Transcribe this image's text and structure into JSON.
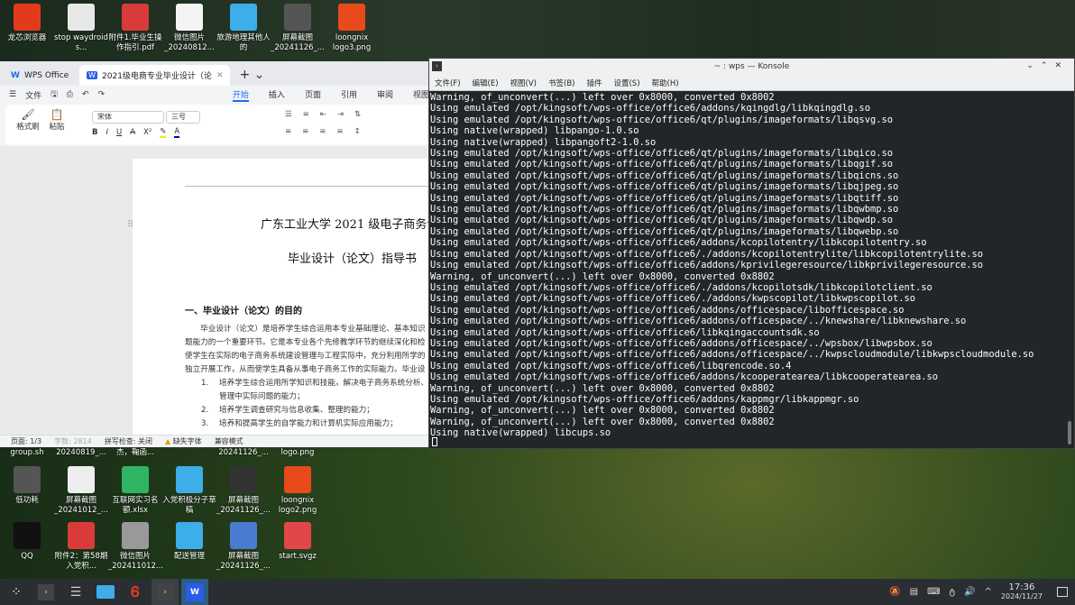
{
  "desktop_top": [
    {
      "label": "龙芯浏览器",
      "icon": "loongson-browser-icon",
      "color": "#e23b1c"
    },
    {
      "label": "stop waydroid s...",
      "icon": "script-file-icon",
      "color": "#e8e8e8"
    },
    {
      "label": "附件1.毕业生操作指引.pdf",
      "icon": "pdf-icon",
      "color": "#d93a3a"
    },
    {
      "label": "微信图片_20240812...",
      "icon": "image-file-icon",
      "color": "#f4f4f4"
    },
    {
      "label": "旅游地理其他人的",
      "icon": "folder-icon",
      "color": "#3daee9"
    },
    {
      "label": "屏幕截图_20241126_...",
      "icon": "screenshot-icon",
      "color": "#555"
    },
    {
      "label": "loongnix logo3.png",
      "icon": "loongnix-logo-icon",
      "color": "#e84a1c"
    }
  ],
  "desktop_bottom_partial": [
    "group.sh",
    "20240819_...",
    "杰，鞠函...",
    "20241126_...",
    "logo.png"
  ],
  "desktop_bottom": [
    {
      "label": "低功耗",
      "icon": "terminal-script-icon",
      "color": "#555"
    },
    {
      "label": "屏幕截图_20241012_...",
      "icon": "screenshot-icon",
      "color": "#eee"
    },
    {
      "label": "互联网实习名额.xlsx",
      "icon": "spreadsheet-icon",
      "color": "#2fb464"
    },
    {
      "label": "入党积极分子草稿",
      "icon": "folder-icon",
      "color": "#3daee9"
    },
    {
      "label": "屏幕截图_20241126_...",
      "icon": "screenshot-icon",
      "color": "#333"
    },
    {
      "label": "loongnix logo2.png",
      "icon": "loongnix-logo-icon",
      "color": "#e84a1c"
    },
    {
      "label": "QQ",
      "icon": "qq-icon",
      "color": "#111"
    },
    {
      "label": "附件2：第58期入党积...",
      "icon": "pdf-icon",
      "color": "#d93a3a"
    },
    {
      "label": "微信图片_202411012...",
      "icon": "image-file-icon",
      "color": "#999"
    },
    {
      "label": "配送管理",
      "icon": "folder-icon",
      "color": "#3daee9"
    },
    {
      "label": "屏幕截图_20241126_...",
      "icon": "screenshot-icon",
      "color": "#4a7bd0"
    },
    {
      "label": "start.svgz",
      "icon": "svg-file-icon",
      "color": "#e04848"
    }
  ],
  "wps": {
    "tabs": [
      "WPS Office",
      "2021级电商专业毕业设计（论"
    ],
    "file_menu": "文件",
    "ribbon_tabs": [
      "开始",
      "插入",
      "页面",
      "引用",
      "审阅",
      "视图"
    ],
    "active_ribbon": "开始",
    "format_painter": "格式刷",
    "paste": "粘贴",
    "font": "宋体",
    "size": "三号",
    "doc": {
      "title1": "广东工业大学 2021 级电子商务专",
      "title2": "毕业设计（论文）指导书",
      "heading": "一、毕业设计（论文）的目的",
      "para": [
        "　　毕业设计（论文）是培养学生综合运用本专业基础理论、基本知识",
        "题能力的一个重要环节。它是本专业各个先修教学环节的继续深化和检",
        "使学生在实际的电子商务系统建设管理与工程实际中，充分利用所学的",
        "独立开展工作，从而使学生具备从事电子商务工作的实际能力。毕业设"
      ],
      "list": [
        {
          "n": "1.",
          "t": "培养学生综合运用所学知识和技能，解决电子商务系统分析、"
        },
        {
          "n": "",
          "t": "管理中实际问题的能力；"
        },
        {
          "n": "2.",
          "t": "培养学生调查研究与信息收集、整理的能力；"
        },
        {
          "n": "3.",
          "t": "培养和提高学生的自学能力和计算机实际应用能力；"
        }
      ]
    },
    "status": {
      "page": "页面: 1/3",
      "words": "字数: 2814",
      "spell": "拼写检查: 关闭",
      "missing_font": "缺失字体",
      "compat": "兼容模式"
    }
  },
  "konsole": {
    "title": "~ : wps — Konsole",
    "menu": [
      "文件(F)",
      "编辑(E)",
      "视图(V)",
      "书签(B)",
      "插件",
      "设置(S)",
      "帮助(H)"
    ],
    "lines": [
      "Warning, of_unconvert(...) left over 0x8000, converted 0x8002",
      "Using emulated /opt/kingsoft/wps-office/office6/addons/kqingdlg/libkqingdlg.so",
      "Using emulated /opt/kingsoft/wps-office/office6/qt/plugins/imageformats/libqsvg.so",
      "Using native(wrapped) libpango-1.0.so",
      "Using native(wrapped) libpangoft2-1.0.so",
      "Using emulated /opt/kingsoft/wps-office/office6/qt/plugins/imageformats/libqico.so",
      "Using emulated /opt/kingsoft/wps-office/office6/qt/plugins/imageformats/libqgif.so",
      "Using emulated /opt/kingsoft/wps-office/office6/qt/plugins/imageformats/libqicns.so",
      "Using emulated /opt/kingsoft/wps-office/office6/qt/plugins/imageformats/libqjpeg.so",
      "Using emulated /opt/kingsoft/wps-office/office6/qt/plugins/imageformats/libqtiff.so",
      "Using emulated /opt/kingsoft/wps-office/office6/qt/plugins/imageformats/libqwbmp.so",
      "Using emulated /opt/kingsoft/wps-office/office6/qt/plugins/imageformats/libqwdp.so",
      "Using emulated /opt/kingsoft/wps-office/office6/qt/plugins/imageformats/libqwebp.so",
      "Using emulated /opt/kingsoft/wps-office/office6/addons/kcopilotentry/libkcopilotentry.so",
      "Using emulated /opt/kingsoft/wps-office/office6/./addons/kcopilotentrylite/libkcopilotentrylite.so",
      "Using emulated /opt/kingsoft/wps-office/office6/addons/kprivilegeresource/libkprivilegeresource.so",
      "Warning, of_unconvert(...) left over 0x8000, converted 0x8802",
      "Using emulated /opt/kingsoft/wps-office/office6/./addons/kcopilotsdk/libkcopilotclient.so",
      "Using emulated /opt/kingsoft/wps-office/office6/./addons/kwpscopilot/libkwpscopilot.so",
      "Using emulated /opt/kingsoft/wps-office/office6/addons/officespace/libofficespace.so",
      "Using emulated /opt/kingsoft/wps-office/office6/addons/officespace/../knewshare/libknewshare.so",
      "Using emulated /opt/kingsoft/wps-office/office6/libkqingaccountsdk.so",
      "Using emulated /opt/kingsoft/wps-office/office6/addons/officespace/../wpsbox/libwpsbox.so",
      "Using emulated /opt/kingsoft/wps-office/office6/addons/officespace/../kwpscloudmodule/libkwpscloudmodule.so",
      "Using emulated /opt/kingsoft/wps-office/office6/libqrencode.so.4",
      "Using emulated /opt/kingsoft/wps-office/office6/addons/kcooperatearea/libkcooperatearea.so",
      "Warning, of_unconvert(...) left over 0x8000, converted 0x8802",
      "Using emulated /opt/kingsoft/wps-office/office6/addons/kappmgr/libkappmgr.so",
      "Warning, of_unconvert(...) left over 0x8000, converted 0x8802",
      "Warning, of_unconvert(...) left over 0x8000, converted 0x8802",
      "Using native(wrapped) libcups.so"
    ]
  },
  "tray": {
    "time": "17:36",
    "date": "2024/11/27"
  },
  "accent": "#1a6cf0"
}
